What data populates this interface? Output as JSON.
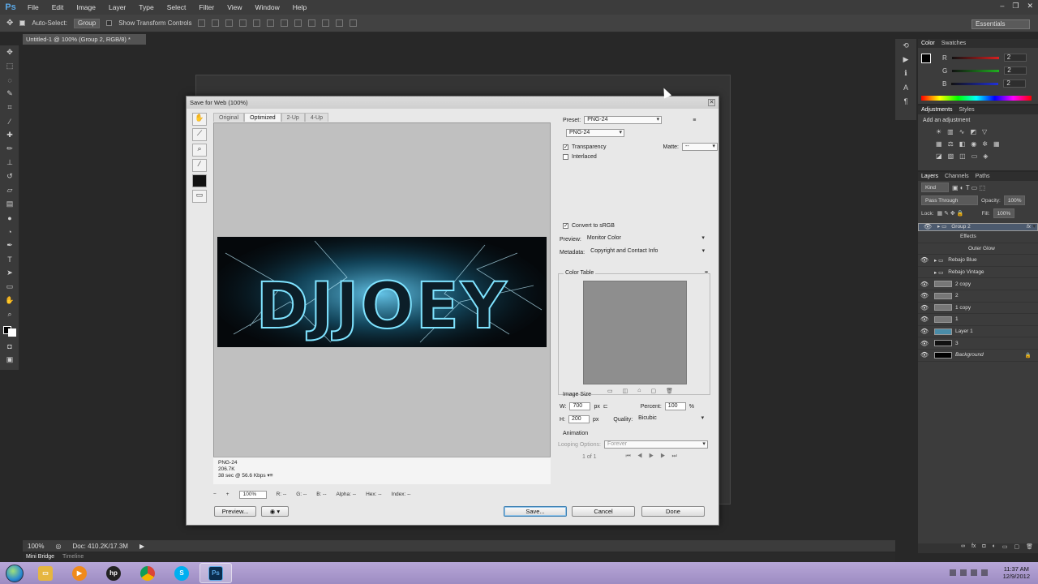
{
  "menubar": {
    "logo": "Ps",
    "items": [
      "File",
      "Edit",
      "Image",
      "Layer",
      "Type",
      "Select",
      "Filter",
      "View",
      "Window",
      "Help"
    ]
  },
  "optionsbar": {
    "auto_select_label": "Auto-Select:",
    "auto_select_value": "Group",
    "show_transform_label": "Show Transform Controls",
    "workspace": "Essentials"
  },
  "document": {
    "tab_title": "Untitled-1 @ 100% (Group 2, RGB/8) *"
  },
  "color_panel": {
    "tabs": [
      "Color",
      "Swatches"
    ],
    "channels": [
      {
        "label": "R",
        "value": "2",
        "color": "#d82020"
      },
      {
        "label": "G",
        "value": "2",
        "color": "#20b020"
      },
      {
        "label": "B",
        "value": "2",
        "color": "#2030d8"
      }
    ]
  },
  "adjustments_panel": {
    "tabs": [
      "Adjustments",
      "Styles"
    ],
    "heading": "Add an adjustment"
  },
  "layers_panel": {
    "tabs": [
      "Layers",
      "Channels",
      "Paths"
    ],
    "kind": "Kind",
    "blend_mode": "Pass Through",
    "opacity_label": "Opacity:",
    "opacity": "100%",
    "lock_label": "Lock:",
    "fill_label": "Fill:",
    "fill": "100%",
    "layers": [
      {
        "name": "Group 2",
        "selected": true,
        "fx": "fx"
      },
      {
        "name": "Effects",
        "selected": false
      },
      {
        "name": "Outer Glow",
        "selected": false
      },
      {
        "name": "Rebajo Blue",
        "selected": false
      },
      {
        "name": "Rebajo Vintage",
        "selected": false
      },
      {
        "name": "2 copy",
        "selected": false
      },
      {
        "name": "2",
        "selected": false
      },
      {
        "name": "1 copy",
        "selected": false
      },
      {
        "name": "1",
        "selected": false
      },
      {
        "name": "Layer 1",
        "selected": false
      },
      {
        "name": "3",
        "selected": false
      },
      {
        "name": "Background",
        "selected": false
      }
    ]
  },
  "statusbar": {
    "zoom": "100%",
    "doc": "Doc: 410.2K/17.3M"
  },
  "bottom_tabs": [
    "Mini Bridge",
    "Timeline"
  ],
  "dialog": {
    "title": "Save for Web (100%)",
    "view_tabs": [
      "Original",
      "Optimized",
      "2-Up",
      "4-Up"
    ],
    "image_text": "DJJOEY",
    "preview_info": {
      "format": "PNG-24",
      "size": "206.7K",
      "speed": "38 sec @ 56.6 Kbps"
    },
    "status": {
      "zoom": "100%",
      "r": "R: --",
      "g": "G: --",
      "b": "B: --",
      "alpha": "Alpha: --",
      "hex": "Hex: --",
      "index": "Index: --"
    },
    "settings": {
      "preset_label": "Preset:",
      "preset": "PNG-24",
      "format": "PNG-24",
      "transparency_label": "Transparency",
      "matte_label": "Matte:",
      "matte": "--",
      "interlaced_label": "Interlaced",
      "convert_srgb_label": "Convert to sRGB",
      "preview_label": "Preview:",
      "preview": "Monitor Color",
      "metadata_label": "Metadata:",
      "metadata": "Copyright and Contact Info",
      "color_table_label": "Color Table",
      "image_size_label": "Image Size",
      "w_label": "W:",
      "w": "700",
      "h_label": "H:",
      "h": "200",
      "px": "px",
      "percent_label": "Percent:",
      "percent": "100",
      "percent_unit": "%",
      "quality_label": "Quality:",
      "quality": "Bicubic",
      "animation_label": "Animation",
      "looping_label": "Looping Options:",
      "looping": "Forever",
      "frame": "1 of 1"
    },
    "buttons": {
      "preview": "Preview...",
      "save": "Save...",
      "cancel": "Cancel",
      "done": "Done"
    }
  },
  "taskbar": {
    "time": "11:37 AM",
    "date": "12/9/2012"
  }
}
